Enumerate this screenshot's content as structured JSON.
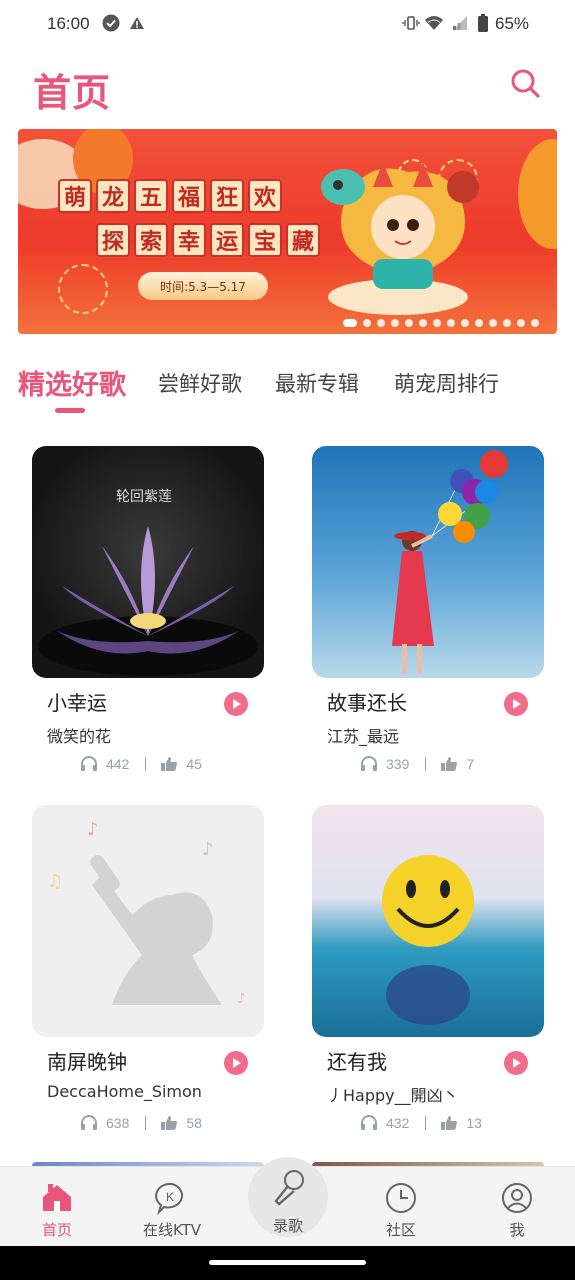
{
  "status_bar": {
    "time": "16:00",
    "battery_percent": "65%",
    "icons": [
      "check-circle-icon",
      "alert-icon",
      "vibrate-icon",
      "wifi-icon",
      "signal-icon",
      "battery-icon"
    ]
  },
  "header": {
    "title": "首页",
    "search_icon": "search-icon"
  },
  "banner": {
    "line1": [
      "萌",
      "龙",
      "五",
      "福",
      "狂",
      "欢"
    ],
    "line2": [
      "探",
      "索",
      "幸",
      "运",
      "宝",
      "藏"
    ],
    "date_text": "时间:5.3—5.17",
    "page_count": 14,
    "active_index": 0
  },
  "tabs": [
    {
      "label": "精选好歌",
      "active": true
    },
    {
      "label": "尝鲜好歌",
      "active": false
    },
    {
      "label": "最新专辑",
      "active": false
    },
    {
      "label": "萌宠周排行",
      "active": false
    }
  ],
  "songs": [
    {
      "title": "小幸运",
      "singer": "微笑的花",
      "listens": "442",
      "likes": "45",
      "cover_caption": "轮回紫莲"
    },
    {
      "title": "故事还长",
      "singer": "江苏_最远",
      "listens": "339",
      "likes": "7"
    },
    {
      "title": "南屏晚钟",
      "singer": "DeccaHome_Simon",
      "listens": "638",
      "likes": "58"
    },
    {
      "title": "还有我",
      "singer": "丿Happy__開凶丶",
      "listens": "432",
      "likes": "13"
    }
  ],
  "bottom_nav": [
    {
      "label": "首页",
      "icon": "home-icon",
      "active": true
    },
    {
      "label": "在线KTV",
      "icon": "ktv-chat-icon",
      "active": false
    },
    {
      "label": "录歌",
      "icon": "microphone-icon",
      "active": false
    },
    {
      "label": "社区",
      "icon": "clock-icon",
      "active": false
    },
    {
      "label": "我",
      "icon": "user-icon",
      "active": false
    }
  ],
  "colors": {
    "accent": "#e8567a",
    "banner_red": "#ee3a2b",
    "stat_gray": "#9aa0a8"
  }
}
